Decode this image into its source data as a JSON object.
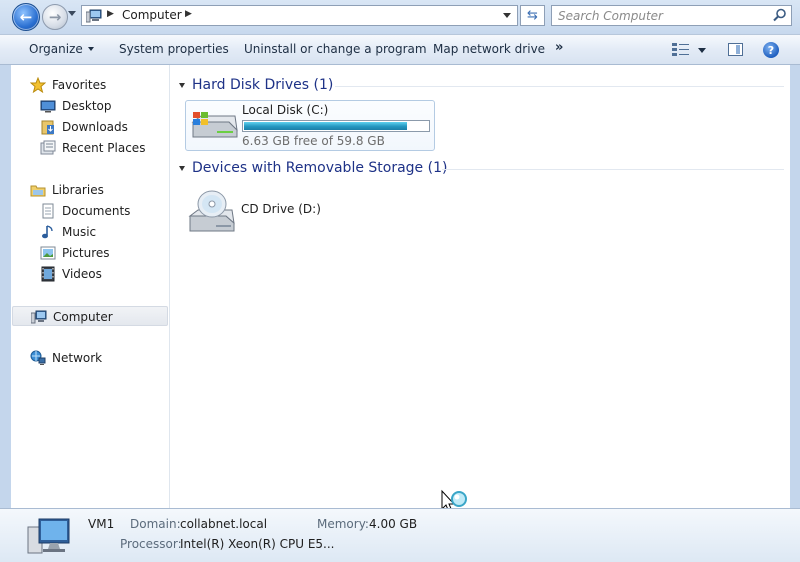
{
  "address_bar": {
    "crumb": "Computer",
    "search_placeholder": "Search Computer"
  },
  "toolbar": {
    "organize": "Organize",
    "system_properties": "System properties",
    "uninstall": "Uninstall or change a program",
    "map_drive": "Map network drive",
    "more": "»"
  },
  "nav": {
    "favorites": "Favorites",
    "desktop": "Desktop",
    "downloads": "Downloads",
    "recent_places": "Recent Places",
    "libraries": "Libraries",
    "documents": "Documents",
    "music": "Music",
    "pictures": "Pictures",
    "videos": "Videos",
    "computer": "Computer",
    "network": "Network"
  },
  "groups": {
    "hdd_title": "Hard Disk Drives (1)",
    "removable_title": "Devices with Removable Storage (1)"
  },
  "drives": {
    "local_disk_name": "Local Disk (C:)",
    "local_disk_free": "6.63 GB free of 59.8 GB",
    "local_disk_used_fraction": 0.889,
    "cd_name": "CD Drive (D:)"
  },
  "details": {
    "computer_name": "VM1",
    "domain_label": "Domain:",
    "domain_value": "collabnet.local",
    "memory_label": "Memory:",
    "memory_value": "4.00 GB",
    "processor_label": "Processor:",
    "processor_value": "Intel(R) Xeon(R) CPU E5..."
  }
}
